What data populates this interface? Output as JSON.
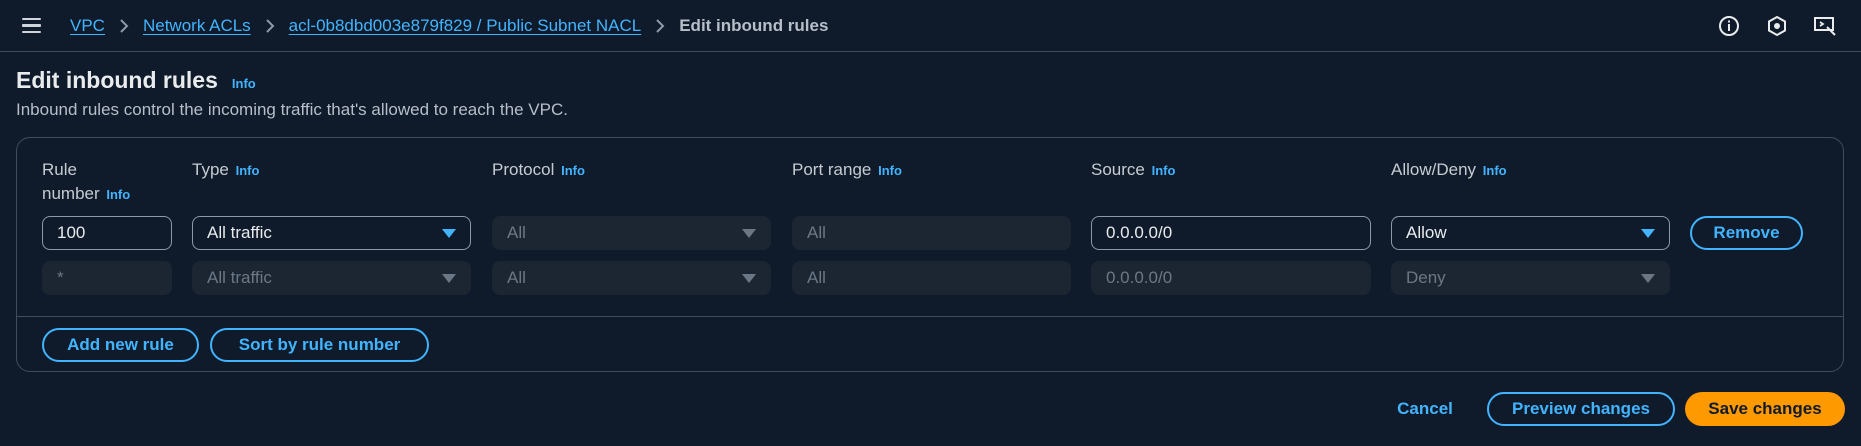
{
  "breadcrumb": {
    "items": [
      "VPC",
      "Network ACLs",
      "acl-0b8dbd003e879f829 / Public Subnet NACL"
    ],
    "current": "Edit inbound rules"
  },
  "header": {
    "title": "Edit inbound rules",
    "info": "Info",
    "description": "Inbound rules control the incoming traffic that's allowed to reach the VPC."
  },
  "columns": {
    "rule_number_line1": "Rule",
    "rule_number_line2": "number",
    "type": "Type",
    "protocol": "Protocol",
    "port_range": "Port range",
    "source": "Source",
    "allow_deny": "Allow/Deny",
    "info": "Info"
  },
  "rules": [
    {
      "number": "100",
      "type": "All traffic",
      "protocol": "All",
      "port_range": "All",
      "source": "0.0.0.0/0",
      "action": "Allow",
      "remove_label": "Remove"
    },
    {
      "number": "*",
      "type": "All traffic",
      "protocol": "All",
      "port_range": "All",
      "source": "0.0.0.0/0",
      "action": "Deny"
    }
  ],
  "actions": {
    "add_rule": "Add new rule",
    "sort": "Sort by rule number",
    "cancel": "Cancel",
    "preview": "Preview changes",
    "save": "Save changes"
  },
  "colors": {
    "accent": "#42b4ff",
    "primary_button": "#ff9900",
    "background": "#0f1b2a"
  }
}
